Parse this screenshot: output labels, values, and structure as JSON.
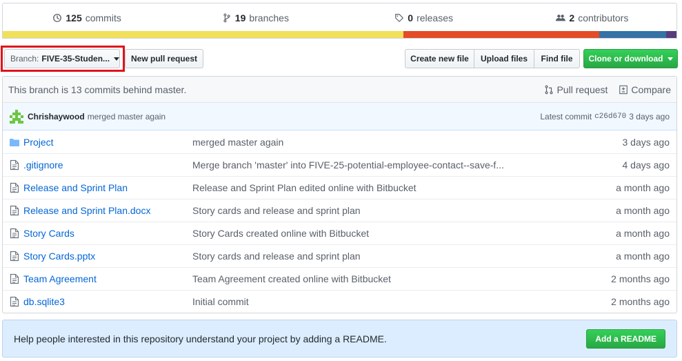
{
  "summary": {
    "commits": {
      "count": "125",
      "label": "commits"
    },
    "branches": {
      "count": "19",
      "label": "branches"
    },
    "releases": {
      "count": "0",
      "label": "releases"
    },
    "contributors": {
      "count": "2",
      "label": "contributors"
    }
  },
  "language_bar": {
    "segments": [
      {
        "fraction": 0.595,
        "color": "#f1e05a"
      },
      {
        "fraction": 0.29,
        "color": "#e34c26"
      },
      {
        "fraction": 0.1,
        "color": "#3572a5"
      },
      {
        "fraction": 0.015,
        "color": "#563d7c"
      }
    ]
  },
  "toolbar": {
    "branch_label": "Branch:",
    "branch_value": "FIVE-35-Studen...",
    "new_pull_request": "New pull request",
    "create_new_file": "Create new file",
    "upload_files": "Upload files",
    "find_file": "Find file",
    "clone_or_download": "Clone or download"
  },
  "branch_status": {
    "text": "This branch is 13 commits behind master.",
    "pull_request": "Pull request",
    "compare": "Compare"
  },
  "latest_commit": {
    "author": "Chrishaywood",
    "message": "merged master again",
    "prefix": "Latest commit",
    "sha": "c26d670",
    "age": "3 days ago"
  },
  "files": [
    {
      "type": "folder-icon",
      "name": "Project",
      "message": "merged master again",
      "age": "3 days ago"
    },
    {
      "type": "file-icon",
      "name": ".gitignore",
      "message": "Merge branch 'master' into FIVE-25-potential-employee-contact--save-f...",
      "age": "4 days ago"
    },
    {
      "type": "file-icon",
      "name": "Release and Sprint Plan",
      "message": "Release and Sprint Plan edited online with Bitbucket",
      "age": "a month ago"
    },
    {
      "type": "file-icon",
      "name": "Release and Sprint Plan.docx",
      "message": "Story cards and release and sprint plan",
      "age": "a month ago"
    },
    {
      "type": "file-icon",
      "name": "Story Cards",
      "message": "Story Cards created online with Bitbucket",
      "age": "a month ago"
    },
    {
      "type": "file-icon",
      "name": "Story Cards.pptx",
      "message": "Story cards and release and sprint plan",
      "age": "a month ago"
    },
    {
      "type": "file-icon",
      "name": "Team Agreement",
      "message": "Team Agreement created online with Bitbucket",
      "age": "2 months ago"
    },
    {
      "type": "file-icon",
      "name": "db.sqlite3",
      "message": "Initial commit",
      "age": "2 months ago"
    }
  ],
  "readme_prompt": {
    "text": "Help people interested in this repository understand your project by adding a README.",
    "button": "Add a README"
  },
  "colors": {
    "link": "#0366d6",
    "primary_button": "#28a745",
    "highlight": "#e0131b"
  }
}
